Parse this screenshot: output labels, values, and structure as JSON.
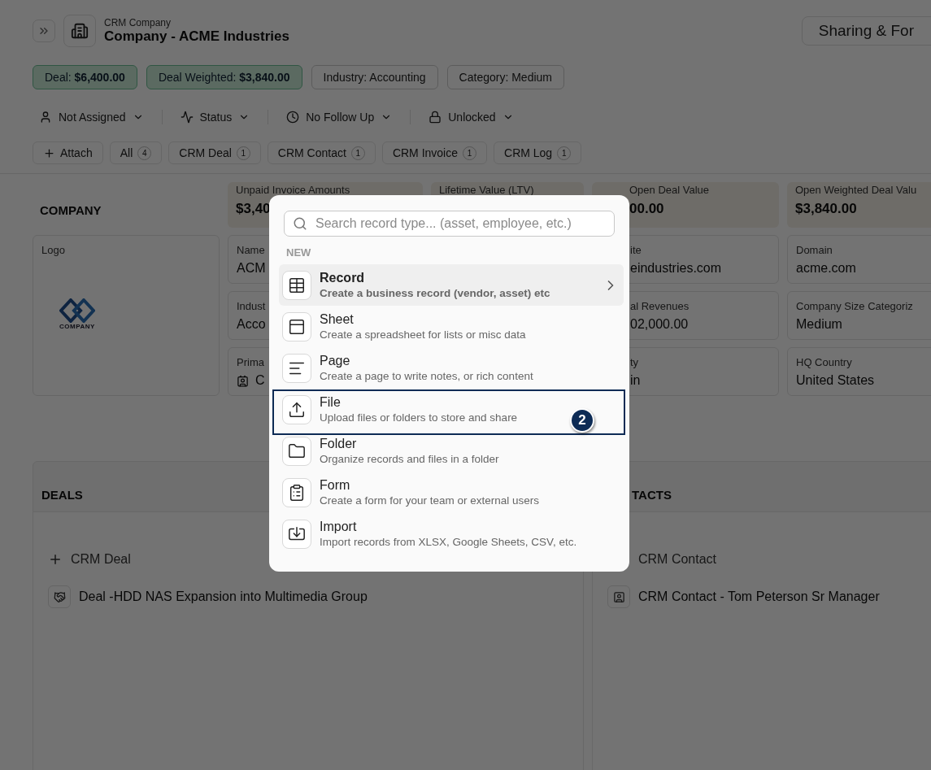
{
  "header": {
    "breadcrumb": "CRM Company",
    "title": "Company - ACME Industries",
    "share_button": "Sharing & For"
  },
  "chips": [
    {
      "text": "Deal: **$6,400.00**",
      "kind": "highlight"
    },
    {
      "text": "Deal Weighted: **$3,840.00**",
      "kind": "highlight"
    },
    {
      "text": "Industry: Accounting",
      "kind": "plain"
    },
    {
      "text": "Category: Medium",
      "kind": "plain"
    }
  ],
  "properties": [
    {
      "label": "Not Assigned"
    },
    {
      "label": "Status"
    },
    {
      "label": "No Follow Up"
    },
    {
      "label": "Unlocked"
    }
  ],
  "tabs": [
    {
      "kind": "action",
      "label": "Attach"
    },
    {
      "kind": "filter",
      "label": "All",
      "count": "4"
    },
    {
      "kind": "filter",
      "label": "CRM Deal",
      "count": "1"
    },
    {
      "kind": "filter",
      "label": "CRM Contact",
      "count": "1"
    },
    {
      "kind": "filter",
      "label": "CRM Invoice",
      "count": "1"
    },
    {
      "kind": "filter",
      "label": "CRM Log",
      "count": "1"
    }
  ],
  "company": {
    "heading": "COMPANY",
    "stats": [
      {
        "label": "Unpaid Invoice Amounts",
        "value": "$3,40"
      },
      {
        "label": "Lifetime Value (LTV)"
      },
      {
        "label": "Open Deal Value",
        "value": "00.00"
      },
      {
        "label": "Open Weighted Deal Valu",
        "value": "$3,840.00"
      }
    ],
    "logo": {
      "label": "Logo",
      "logo_text": "COMPANY"
    },
    "fields": [
      {
        "label": "Name",
        "value": "ACM",
        "kind": "text"
      },
      {
        "label": "ite",
        "value": "eindustries.com",
        "kind": "text"
      },
      {
        "label": "Domain",
        "value": "acme.com",
        "kind": "text"
      },
      {
        "label": "Indust",
        "value": "Acco",
        "kind": "text"
      },
      {
        "label": "al Revenues",
        "value": "02,000.00",
        "kind": "text"
      },
      {
        "label": "Company Size Categoriz",
        "value": "Medium",
        "kind": "text"
      },
      {
        "label": "Prima",
        "value": "C",
        "kind": "link"
      },
      {
        "label": "ty",
        "value": "in",
        "kind": "text"
      },
      {
        "label": "HQ Country",
        "value": "United States",
        "kind": "text"
      }
    ]
  },
  "panels": [
    {
      "heading": "DEALS",
      "add_label": "CRM Deal",
      "items": [
        "Deal -HDD NAS Expansion into Multimedia Group"
      ]
    },
    {
      "heading": "TACTS",
      "add_label": "CRM Contact",
      "items": [
        "CRM Contact - Tom Peterson Sr Manager"
      ]
    }
  ],
  "dialog": {
    "search": {
      "placeholder": "Search record type... (asset, employee, etc.)"
    },
    "section": "NEW",
    "items": [
      {
        "title": "Record",
        "description": "Create a business record (vendor, asset) etc",
        "selected": true,
        "has_submenu": true
      },
      {
        "title": "Sheet",
        "description": "Create a spreadsheet for lists or misc data",
        "selected": false,
        "has_submenu": false
      },
      {
        "title": "Page",
        "description": "Create a page to write notes, or rich content",
        "selected": false,
        "has_submenu": false
      },
      {
        "title": "File",
        "description": "Upload files or folders to store and share",
        "selected": false,
        "has_submenu": false,
        "callout": "2"
      },
      {
        "title": "Folder",
        "description": "Organize records and files in a folder",
        "selected": false,
        "has_submenu": false
      },
      {
        "title": "Form",
        "description": "Create a form for your team or external users",
        "selected": false,
        "has_submenu": false
      },
      {
        "title": "Import",
        "description": "Import records from XLSX, Google Sheets, CSV, etc.",
        "selected": false,
        "has_submenu": false
      }
    ]
  }
}
